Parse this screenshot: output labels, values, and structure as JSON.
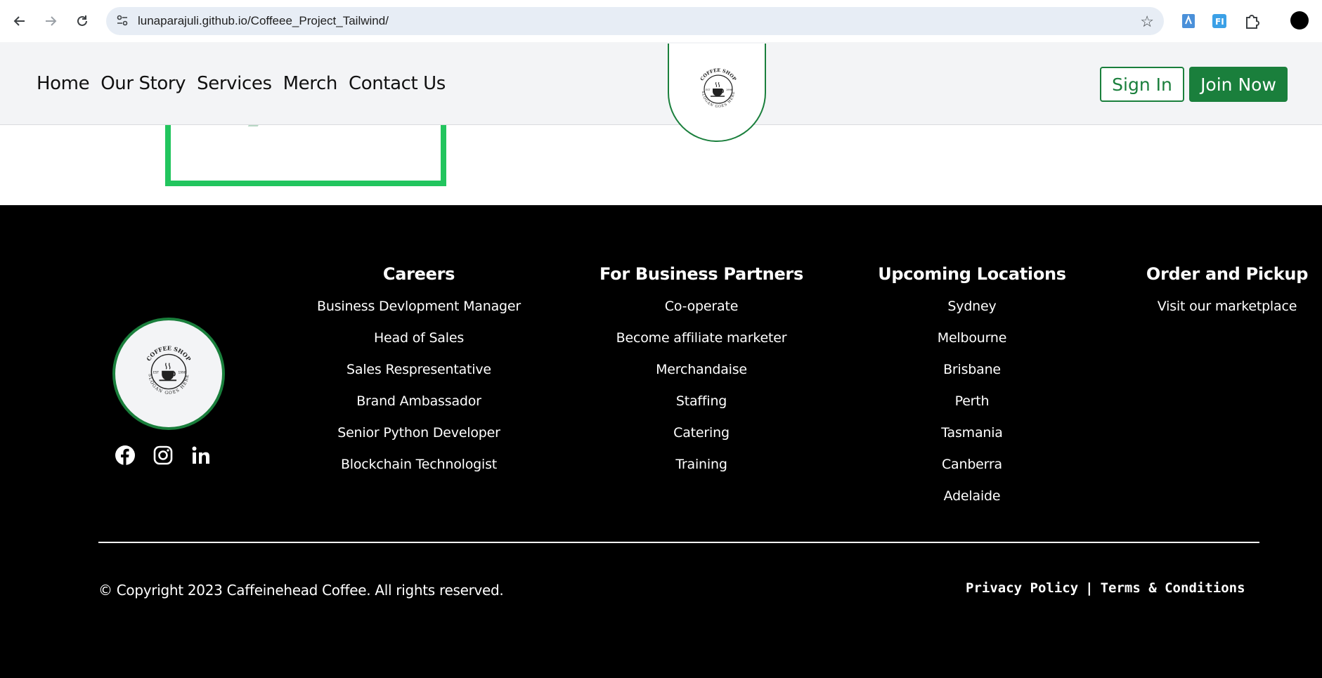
{
  "browser": {
    "url": "lunaparajuli.github.io/Coffeee_Project_Tailwind/",
    "icons": [
      "back-icon",
      "forward-icon",
      "reload-icon",
      "site-info-icon",
      "star-icon",
      "extension-icon",
      "profile-avatar"
    ]
  },
  "header": {
    "nav": [
      "Home",
      "Our Story",
      "Services",
      "Merch",
      "Contact Us"
    ],
    "logo_top_text": "COFFEE SHOP",
    "logo_bottom_text": "SLOGAN GOES HERE",
    "logo_est": "EST",
    "logo_year": "1998",
    "sign_in": "Sign In",
    "join_now": "Join Now"
  },
  "footer": {
    "columns": [
      {
        "title": "Careers",
        "items": [
          "Business Devlopment Manager",
          "Head of Sales",
          "Sales Respresentative",
          "Brand Ambassador",
          "Senior Python Developer",
          "Blockchain Technologist"
        ]
      },
      {
        "title": "For Business Partners",
        "items": [
          "Co-operate",
          "Become affiliate marketer",
          "Merchandaise",
          "Staffing",
          "Catering",
          "Training"
        ]
      },
      {
        "title": "Upcoming Locations",
        "items": [
          "Sydney",
          "Melbourne",
          "Brisbane",
          "Perth",
          "Tasmania",
          "Canberra",
          "Adelaide"
        ]
      },
      {
        "title": "Order and Pickup",
        "items": [
          "Visit our marketplace"
        ]
      }
    ],
    "social": [
      "facebook-icon",
      "instagram-icon",
      "linkedin-icon"
    ],
    "copyright": "© Copyright 2023 Caffeinehead Coffee. All rights reserved.",
    "privacy": "Privacy Policy",
    "separator": "|",
    "terms": "Terms & Conditions"
  },
  "colors": {
    "brand_green": "#1a7f3c",
    "frame_green": "#22c55e",
    "footer_bg": "#000000",
    "header_bg": "#f3f4f6"
  }
}
